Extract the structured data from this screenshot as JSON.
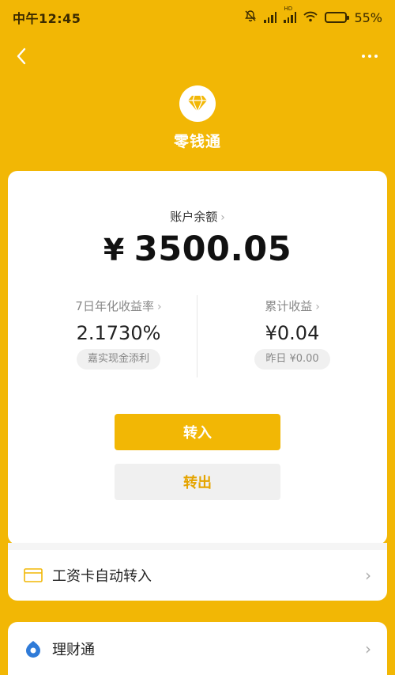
{
  "status_bar": {
    "time": "中午12:45",
    "battery": "55%",
    "hd_label": "HD"
  },
  "brand": {
    "name": "零钱通"
  },
  "balance": {
    "label": "账户余额",
    "currency": "¥",
    "amount": "3500.05"
  },
  "stats": {
    "rate_label": "7日年化收益率",
    "rate_value": "2.1730%",
    "rate_note": "嘉实现金添利",
    "earn_label": "累计收益",
    "earn_value": "¥0.04",
    "earn_note": "昨日 ¥0.00"
  },
  "buttons": {
    "transfer_in": "转入",
    "transfer_out": "转出"
  },
  "rows": {
    "salary": "工资卡自动转入",
    "licai": "理财通"
  },
  "colors": {
    "brand": "#F2B705",
    "accent_text": "#E5A400"
  }
}
